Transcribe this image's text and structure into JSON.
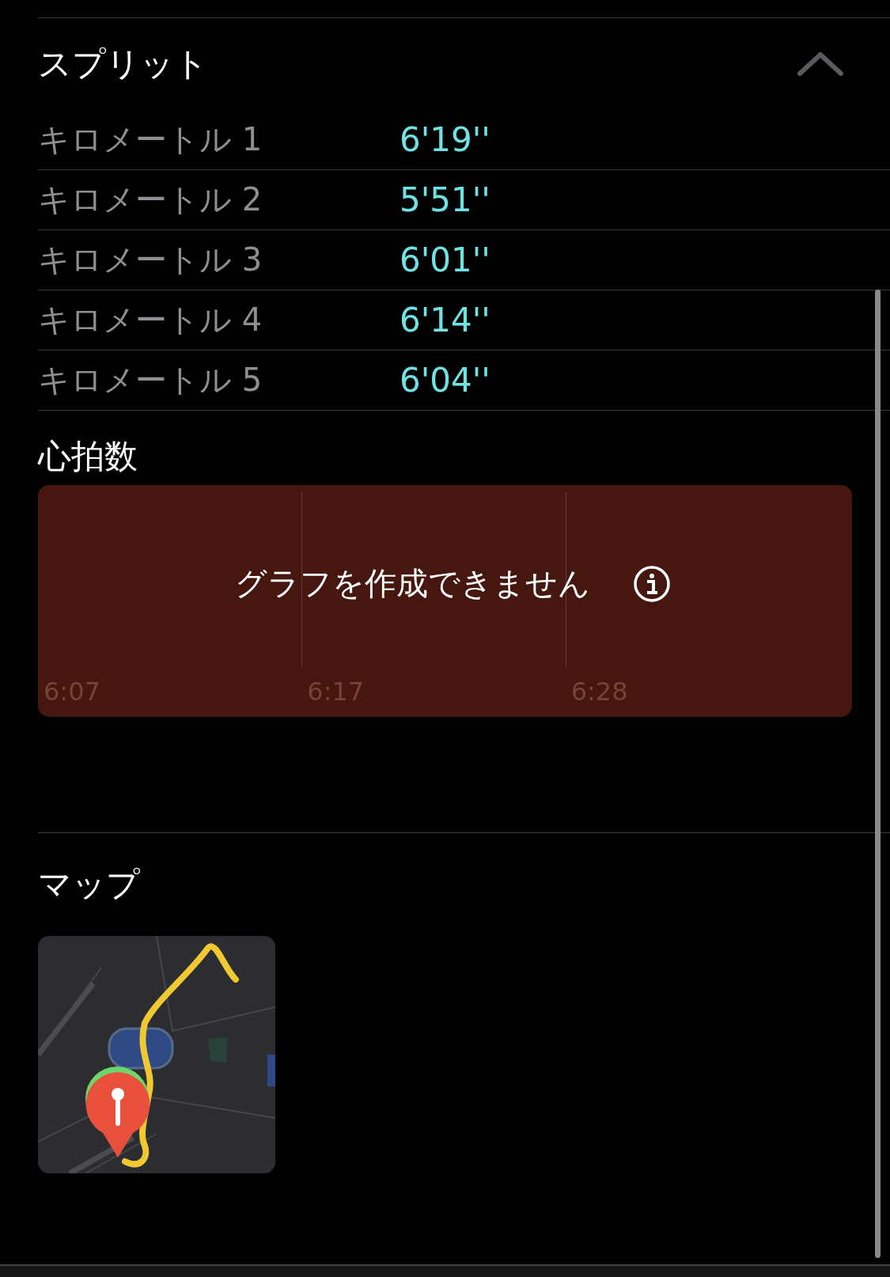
{
  "splits": {
    "title": "スプリット",
    "expanded": true,
    "rows": [
      {
        "label": "キロメートル 1",
        "pace": "6'19''"
      },
      {
        "label": "キロメートル 2",
        "pace": "5'51''"
      },
      {
        "label": "キロメートル 3",
        "pace": "6'01''"
      },
      {
        "label": "キロメートル 4",
        "pace": "6'14''"
      },
      {
        "label": "キロメートル 5",
        "pace": "6'04''"
      }
    ]
  },
  "heart_rate": {
    "title": "心拍数",
    "message": "グラフを作成できません",
    "x_labels": [
      "6:07",
      "6:17",
      "6:28"
    ]
  },
  "map": {
    "title": "マップ",
    "kind": "picture"
  }
}
